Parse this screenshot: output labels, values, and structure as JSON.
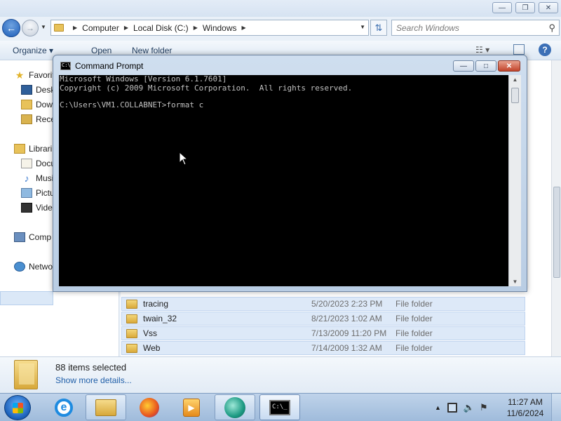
{
  "explorer": {
    "breadcrumbs": [
      "Computer",
      "Local Disk (C:)",
      "Windows"
    ],
    "search_placeholder": "Search Windows",
    "toolbar": {
      "organize": "Organize",
      "open": "Open",
      "new_folder": "New folder"
    },
    "nav": {
      "favorites": "Favorit",
      "desktop": "Desk",
      "downloads": "Dow",
      "recent": "Rece",
      "libraries": "Librari",
      "documents": "Docu",
      "music": "Musi",
      "pictures": "Pictu",
      "videos": "Vide",
      "computer": "Comp",
      "network": "Netwo"
    },
    "files": [
      {
        "name": "tracing",
        "date": "5/20/2023 2:23 PM",
        "type": "File folder"
      },
      {
        "name": "twain_32",
        "date": "8/21/2023 1:02 AM",
        "type": "File folder"
      },
      {
        "name": "Vss",
        "date": "7/13/2009 11:20 PM",
        "type": "File folder"
      },
      {
        "name": "Web",
        "date": "7/14/2009 1:32 AM",
        "type": "File folder"
      }
    ],
    "details": {
      "selection": "88 items selected",
      "show_more": "Show more details..."
    }
  },
  "cmd": {
    "title": "Command Prompt",
    "lines": [
      "Microsoft Windows [Version 6.1.7601]",
      "Copyright (c) 2009 Microsoft Corporation.  All rights reserved.",
      "C:\\Users\\VM1.COLLABNET>format c"
    ]
  },
  "taskbar": {
    "apps": [
      "internet-explorer",
      "windows-explorer",
      "firefox",
      "media-player",
      "sphere-app",
      "command-prompt"
    ],
    "time": "11:27 AM",
    "date": "11/6/2024"
  },
  "colors": {
    "console_bg": "#000000",
    "console_text": "#c0c0c0",
    "selection": "#dde9f8",
    "link": "#1f5ea8"
  }
}
